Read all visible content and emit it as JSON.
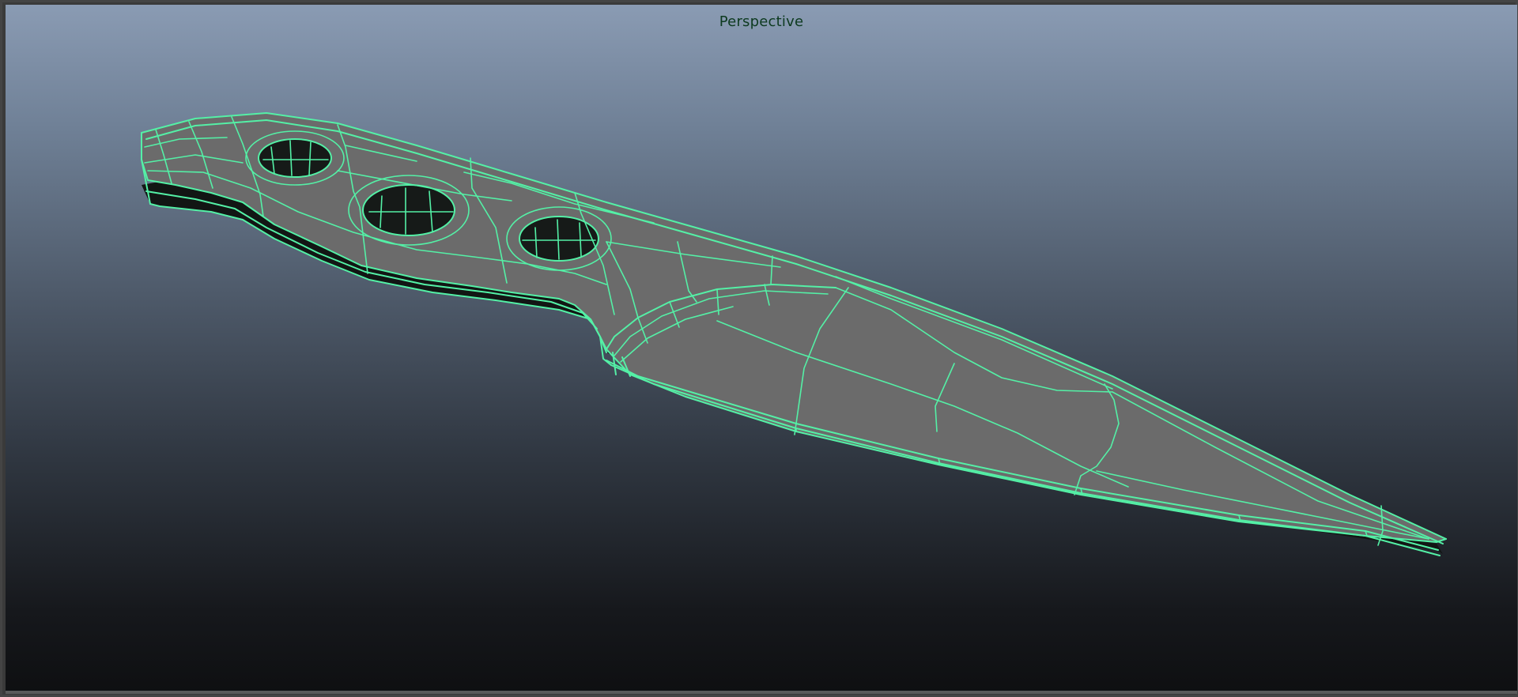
{
  "viewport": {
    "camera_label": "Perspective",
    "panel": "perspective-view"
  },
  "scene": {
    "object": "knife-mesh",
    "display_mode": "wireframe-on-shaded",
    "wire_color": "#54f0a6",
    "shaded_color": "#6b6b6b",
    "background_top": "#8a9bb3",
    "background_bottom": "#0e0f11",
    "handle_hole_count": 3
  }
}
